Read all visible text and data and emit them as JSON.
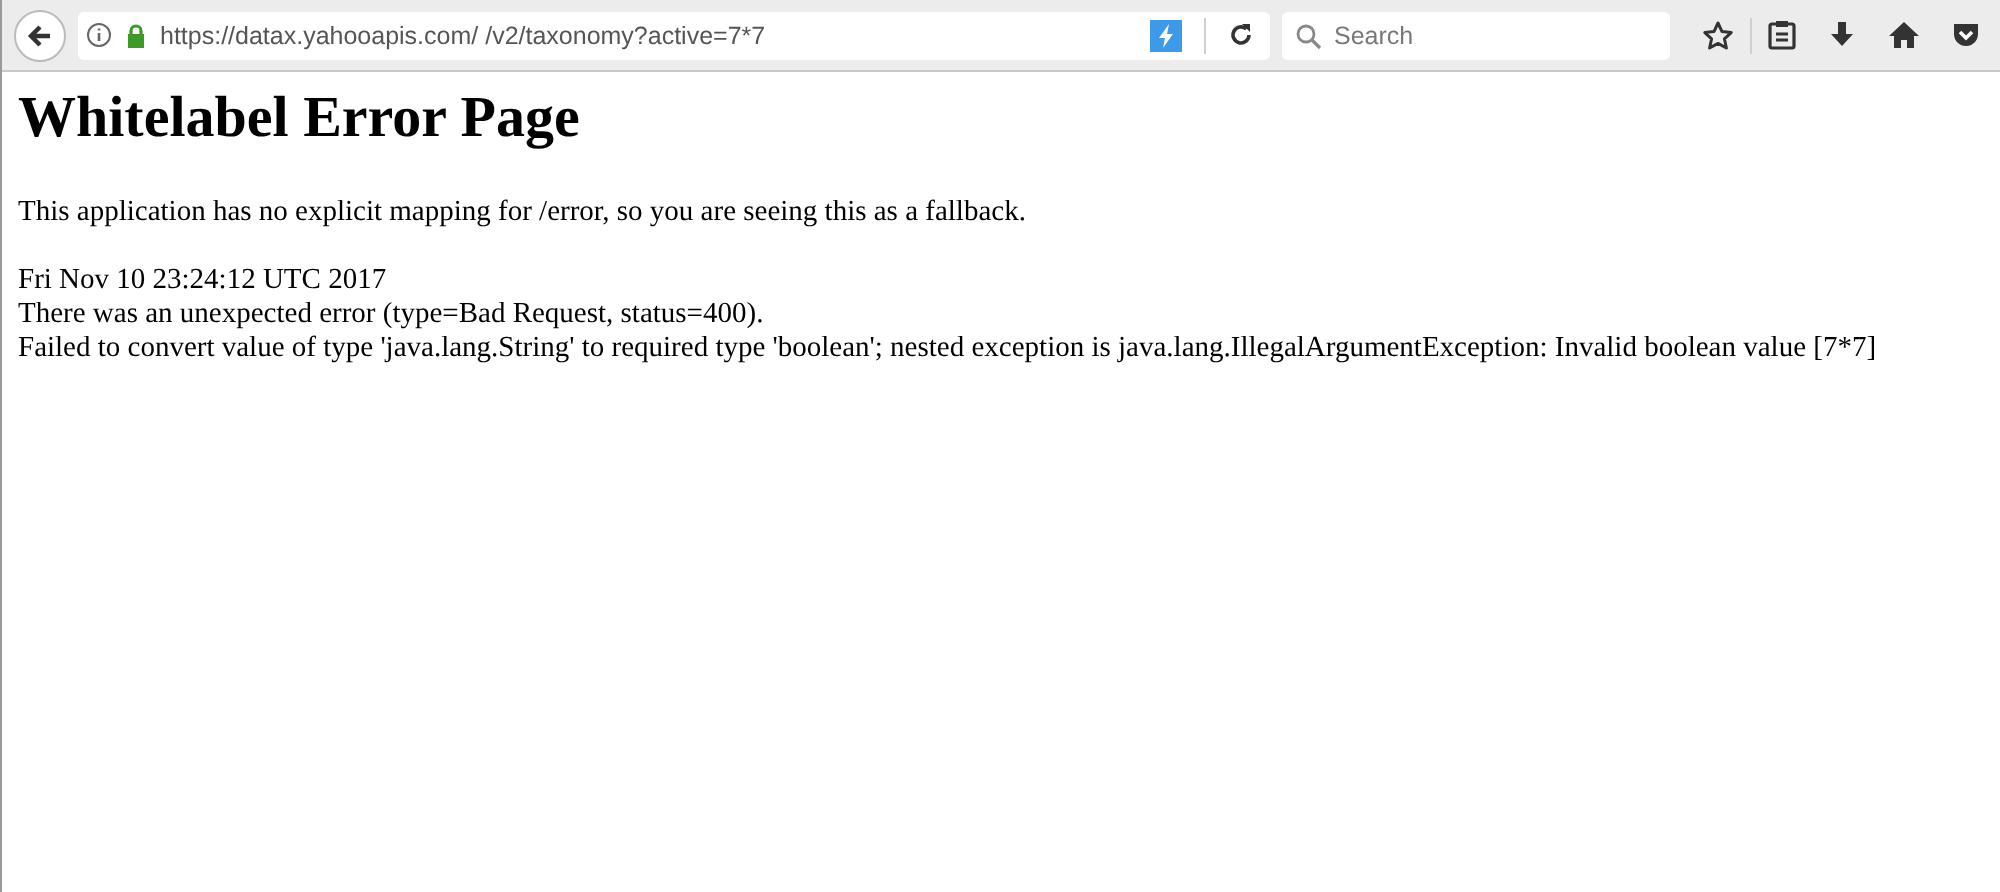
{
  "toolbar": {
    "url": "https://datax.yahooapis.com/ /v2/taxonomy?active=7*7",
    "search": {
      "placeholder": "Search"
    }
  },
  "page": {
    "heading": "Whitelabel Error Page",
    "paragraphs": [
      "This application has no explicit mapping for /error, so you are seeing this as a fallback."
    ],
    "details": [
      "Fri Nov 10 23:24:12 UTC 2017",
      "There was an unexpected error (type=Bad Request, status=400).",
      "Failed to convert value of type 'java.lang.String' to required type 'boolean'; nested exception is java.lang.IllegalArgumentException: Invalid boolean value [7*7]"
    ]
  }
}
